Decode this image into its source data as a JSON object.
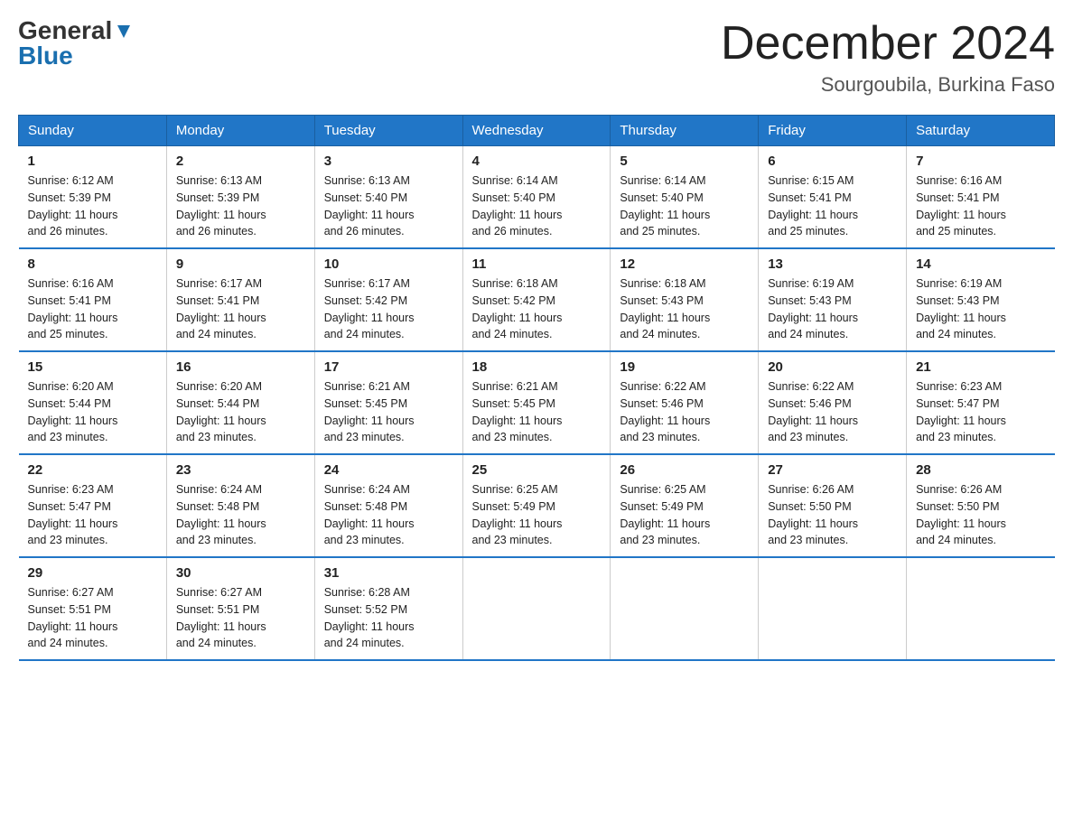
{
  "header": {
    "logo_general": "General",
    "logo_blue": "Blue",
    "month_title": "December 2024",
    "location": "Sourgoubila, Burkina Faso"
  },
  "weekdays": [
    "Sunday",
    "Monday",
    "Tuesday",
    "Wednesday",
    "Thursday",
    "Friday",
    "Saturday"
  ],
  "weeks": [
    [
      {
        "day": "1",
        "sunrise": "6:12 AM",
        "sunset": "5:39 PM",
        "daylight": "11 hours and 26 minutes."
      },
      {
        "day": "2",
        "sunrise": "6:13 AM",
        "sunset": "5:39 PM",
        "daylight": "11 hours and 26 minutes."
      },
      {
        "day": "3",
        "sunrise": "6:13 AM",
        "sunset": "5:40 PM",
        "daylight": "11 hours and 26 minutes."
      },
      {
        "day": "4",
        "sunrise": "6:14 AM",
        "sunset": "5:40 PM",
        "daylight": "11 hours and 26 minutes."
      },
      {
        "day": "5",
        "sunrise": "6:14 AM",
        "sunset": "5:40 PM",
        "daylight": "11 hours and 25 minutes."
      },
      {
        "day": "6",
        "sunrise": "6:15 AM",
        "sunset": "5:41 PM",
        "daylight": "11 hours and 25 minutes."
      },
      {
        "day": "7",
        "sunrise": "6:16 AM",
        "sunset": "5:41 PM",
        "daylight": "11 hours and 25 minutes."
      }
    ],
    [
      {
        "day": "8",
        "sunrise": "6:16 AM",
        "sunset": "5:41 PM",
        "daylight": "11 hours and 25 minutes."
      },
      {
        "day": "9",
        "sunrise": "6:17 AM",
        "sunset": "5:41 PM",
        "daylight": "11 hours and 24 minutes."
      },
      {
        "day": "10",
        "sunrise": "6:17 AM",
        "sunset": "5:42 PM",
        "daylight": "11 hours and 24 minutes."
      },
      {
        "day": "11",
        "sunrise": "6:18 AM",
        "sunset": "5:42 PM",
        "daylight": "11 hours and 24 minutes."
      },
      {
        "day": "12",
        "sunrise": "6:18 AM",
        "sunset": "5:43 PM",
        "daylight": "11 hours and 24 minutes."
      },
      {
        "day": "13",
        "sunrise": "6:19 AM",
        "sunset": "5:43 PM",
        "daylight": "11 hours and 24 minutes."
      },
      {
        "day": "14",
        "sunrise": "6:19 AM",
        "sunset": "5:43 PM",
        "daylight": "11 hours and 24 minutes."
      }
    ],
    [
      {
        "day": "15",
        "sunrise": "6:20 AM",
        "sunset": "5:44 PM",
        "daylight": "11 hours and 23 minutes."
      },
      {
        "day": "16",
        "sunrise": "6:20 AM",
        "sunset": "5:44 PM",
        "daylight": "11 hours and 23 minutes."
      },
      {
        "day": "17",
        "sunrise": "6:21 AM",
        "sunset": "5:45 PM",
        "daylight": "11 hours and 23 minutes."
      },
      {
        "day": "18",
        "sunrise": "6:21 AM",
        "sunset": "5:45 PM",
        "daylight": "11 hours and 23 minutes."
      },
      {
        "day": "19",
        "sunrise": "6:22 AM",
        "sunset": "5:46 PM",
        "daylight": "11 hours and 23 minutes."
      },
      {
        "day": "20",
        "sunrise": "6:22 AM",
        "sunset": "5:46 PM",
        "daylight": "11 hours and 23 minutes."
      },
      {
        "day": "21",
        "sunrise": "6:23 AM",
        "sunset": "5:47 PM",
        "daylight": "11 hours and 23 minutes."
      }
    ],
    [
      {
        "day": "22",
        "sunrise": "6:23 AM",
        "sunset": "5:47 PM",
        "daylight": "11 hours and 23 minutes."
      },
      {
        "day": "23",
        "sunrise": "6:24 AM",
        "sunset": "5:48 PM",
        "daylight": "11 hours and 23 minutes."
      },
      {
        "day": "24",
        "sunrise": "6:24 AM",
        "sunset": "5:48 PM",
        "daylight": "11 hours and 23 minutes."
      },
      {
        "day": "25",
        "sunrise": "6:25 AM",
        "sunset": "5:49 PM",
        "daylight": "11 hours and 23 minutes."
      },
      {
        "day": "26",
        "sunrise": "6:25 AM",
        "sunset": "5:49 PM",
        "daylight": "11 hours and 23 minutes."
      },
      {
        "day": "27",
        "sunrise": "6:26 AM",
        "sunset": "5:50 PM",
        "daylight": "11 hours and 23 minutes."
      },
      {
        "day": "28",
        "sunrise": "6:26 AM",
        "sunset": "5:50 PM",
        "daylight": "11 hours and 24 minutes."
      }
    ],
    [
      {
        "day": "29",
        "sunrise": "6:27 AM",
        "sunset": "5:51 PM",
        "daylight": "11 hours and 24 minutes."
      },
      {
        "day": "30",
        "sunrise": "6:27 AM",
        "sunset": "5:51 PM",
        "daylight": "11 hours and 24 minutes."
      },
      {
        "day": "31",
        "sunrise": "6:28 AM",
        "sunset": "5:52 PM",
        "daylight": "11 hours and 24 minutes."
      },
      null,
      null,
      null,
      null
    ]
  ],
  "labels": {
    "sunrise": "Sunrise:",
    "sunset": "Sunset:",
    "daylight": "Daylight:"
  }
}
